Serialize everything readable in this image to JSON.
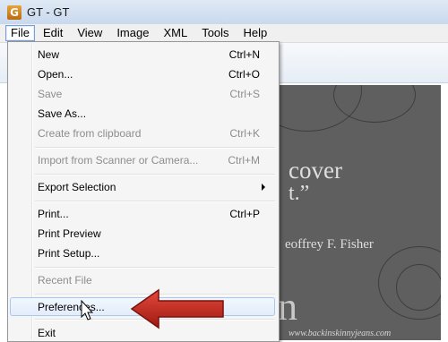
{
  "window": {
    "title": "GT - GT",
    "icon": "app-logo-icon"
  },
  "menubar": [
    "File",
    "Edit",
    "View",
    "Image",
    "XML",
    "Tools",
    "Help"
  ],
  "file_menu": {
    "items": [
      {
        "label": "New",
        "shortcut": "Ctrl+N",
        "enabled": true
      },
      {
        "label": "Open...",
        "shortcut": "Ctrl+O",
        "enabled": true
      },
      {
        "label": "Save",
        "shortcut": "Ctrl+S",
        "enabled": false
      },
      {
        "label": "Save As...",
        "shortcut": "",
        "enabled": true
      },
      {
        "label": "Create from clipboard",
        "shortcut": "Ctrl+K",
        "enabled": false
      },
      {
        "label": "Import from Scanner or Camera...",
        "shortcut": "Ctrl+M",
        "enabled": false
      },
      {
        "label": "Export Selection",
        "shortcut": "",
        "enabled": true,
        "submenu": true
      },
      {
        "label": "Print...",
        "shortcut": "Ctrl+P",
        "enabled": true
      },
      {
        "label": "Print Preview",
        "shortcut": "",
        "enabled": true
      },
      {
        "label": "Print Setup...",
        "shortcut": "",
        "enabled": true
      },
      {
        "label": "Recent File",
        "shortcut": "",
        "enabled": false
      },
      {
        "label": "Preferences...",
        "shortcut": "",
        "enabled": true,
        "highlighted": true
      },
      {
        "label": "Exit",
        "shortcut": "",
        "enabled": true
      }
    ]
  },
  "background_image": {
    "line1": "cover",
    "line2": "t.”",
    "line3": "eoffrey F. Fisher",
    "line4": "n",
    "line5": "www.backinskinnyjeans.com"
  },
  "colors": {
    "annotation_arrow": "#c0251b",
    "menu_highlight": "#a8c8ee",
    "poster_bg": "#5f5f5f"
  }
}
